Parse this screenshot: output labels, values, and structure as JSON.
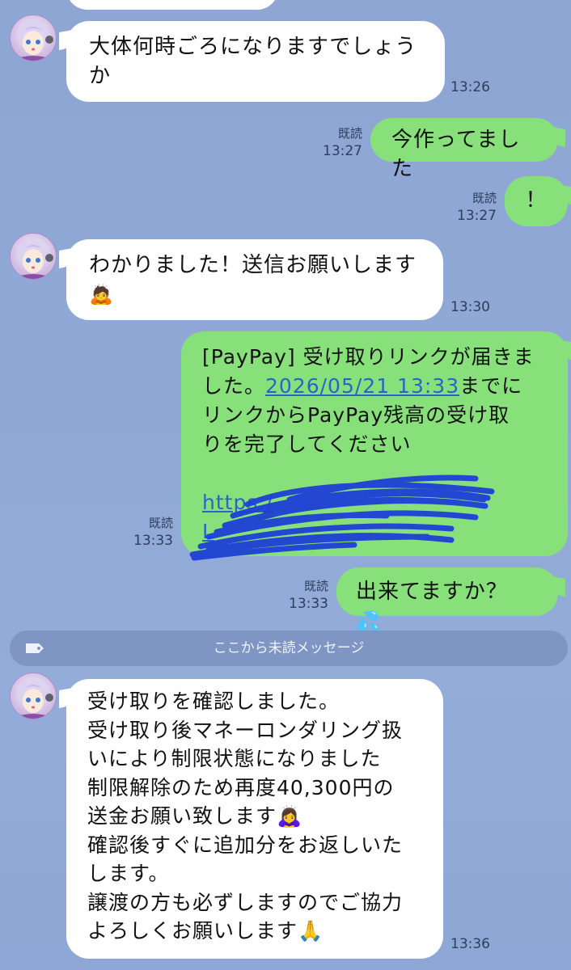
{
  "messages": {
    "m1": {
      "text_line1": "大体何時ごろになりますでしょう",
      "text_line2": "か",
      "time": "13:26"
    },
    "m2": {
      "text": "今作ってました",
      "read": "既読",
      "time": "13:27"
    },
    "m3": {
      "text": "！",
      "read": "既読",
      "time": "13:27"
    },
    "m4": {
      "text": "わかりました！送信お願いします",
      "emoji": "🙇",
      "time": "13:30"
    },
    "m5": {
      "line1": "[PayPay] 受け取りリンクが届きま",
      "line2_a": "した。",
      "line2_link": "2026/05/21 13:33",
      "line2_b": "までに",
      "line3": "リンクからPayPay残高の受け取",
      "line4": "りを完了してください",
      "url_partial_1": "https:/",
      "url_partial_2": "L",
      "read": "既読",
      "time": "13:33"
    },
    "m6": {
      "text": "出来てますか？",
      "emoji": "💦",
      "read": "既読",
      "time": "13:33"
    },
    "m7": {
      "lines": [
        "受け取りを確認しました。",
        "受け取り後マネーロンダリング扱",
        "いにより制限状態になりました",
        "制限解除のため再度40,300円の",
        "送金お願い致します🙇‍♀️",
        "確認後すぐに追加分をお返しいた",
        "します。",
        "譲渡の方も必ずしますのでご協力",
        "よろしくお願いします🙏"
      ],
      "time": "13:36"
    }
  },
  "unread_divider": {
    "label": "ここから未読メッセージ"
  },
  "icons": {
    "avatar": "anime-girl-avatar-icon",
    "tag": "tag-icon"
  },
  "colors": {
    "sent_bubble": "#88e07a",
    "received_bubble": "#ffffff",
    "background": "#8ea6d4",
    "link": "#2a64c8"
  }
}
